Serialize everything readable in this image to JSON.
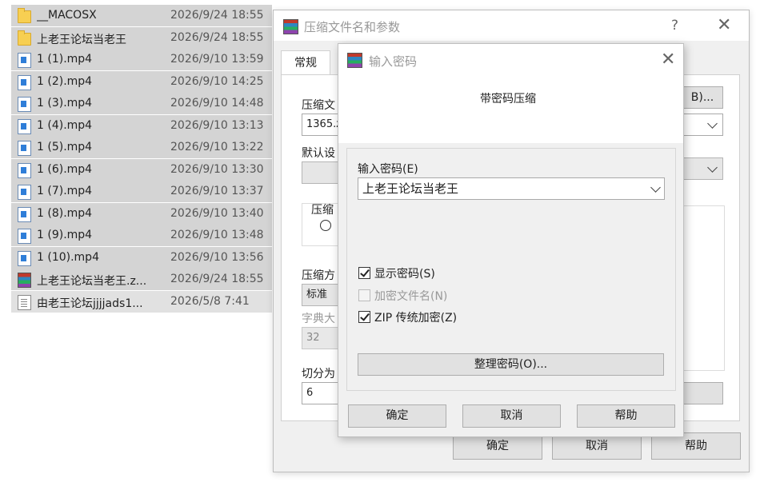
{
  "files": [
    {
      "name": "__MACOSX",
      "date": "2026/9/24 18:55",
      "icon": "folder-icon"
    },
    {
      "name": "上老王论坛当老王",
      "date": "2026/9/24 18:55",
      "icon": "folder-icon"
    },
    {
      "name": "1 (1).mp4",
      "date": "2026/9/10 13:59",
      "icon": "video-file-icon"
    },
    {
      "name": "1 (2).mp4",
      "date": "2026/9/10 14:25",
      "icon": "video-file-icon"
    },
    {
      "name": "1 (3).mp4",
      "date": "2026/9/10 14:48",
      "icon": "video-file-icon"
    },
    {
      "name": "1 (4).mp4",
      "date": "2026/9/10 13:13",
      "icon": "video-file-icon"
    },
    {
      "name": "1 (5).mp4",
      "date": "2026/9/10 13:22",
      "icon": "video-file-icon"
    },
    {
      "name": "1 (6).mp4",
      "date": "2026/9/10 13:30",
      "icon": "video-file-icon"
    },
    {
      "name": "1 (7).mp4",
      "date": "2026/9/10 13:37",
      "icon": "video-file-icon"
    },
    {
      "name": "1 (8).mp4",
      "date": "2026/9/10 13:40",
      "icon": "video-file-icon"
    },
    {
      "name": "1 (9).mp4",
      "date": "2026/9/10 13:48",
      "icon": "video-file-icon"
    },
    {
      "name": "1 (10).mp4",
      "date": "2026/9/10 13:56",
      "icon": "video-file-icon"
    },
    {
      "name": "上老王论坛当老王.z...",
      "date": "2026/9/24 18:55",
      "icon": "archive-file-icon"
    },
    {
      "name": "由老王论坛jjjjads1...",
      "date": "2026/5/8 7:41",
      "icon": "text-file-icon"
    }
  ],
  "main_dialog": {
    "title": "压缩文件名和参数",
    "help_glyph": "?",
    "close_glyph": "✕",
    "tab_general": "常规",
    "archive_name_label": "压缩文",
    "archive_name_value": "1365.z",
    "browse_button": "B)...",
    "default_settings_label": "默认设",
    "archive_format_label": "压缩",
    "format_radio_partial": "",
    "compression_method_label": "压缩方",
    "compression_method_value": "标准",
    "dictionary_label": "字典大",
    "dictionary_value": "32",
    "split_label": "切分为",
    "split_value": "6",
    "ok_button": "确定",
    "cancel_button": "取消",
    "help_button": "帮助"
  },
  "password_dialog": {
    "title": "输入密码",
    "close_glyph": "✕",
    "heading": "带密码压缩",
    "enter_password_label": "输入密码(E)",
    "password_value": "上老王论坛当老王",
    "show_password_label": "显示密码(S)",
    "show_password_checked": true,
    "encrypt_filenames_label": "加密文件名(N)",
    "encrypt_filenames_checked": false,
    "zip_legacy_label": "ZIP 传统加密(Z)",
    "zip_legacy_checked": true,
    "organize_button": "整理密码(O)...",
    "ok_button": "确定",
    "cancel_button": "取消",
    "help_button": "帮助"
  }
}
